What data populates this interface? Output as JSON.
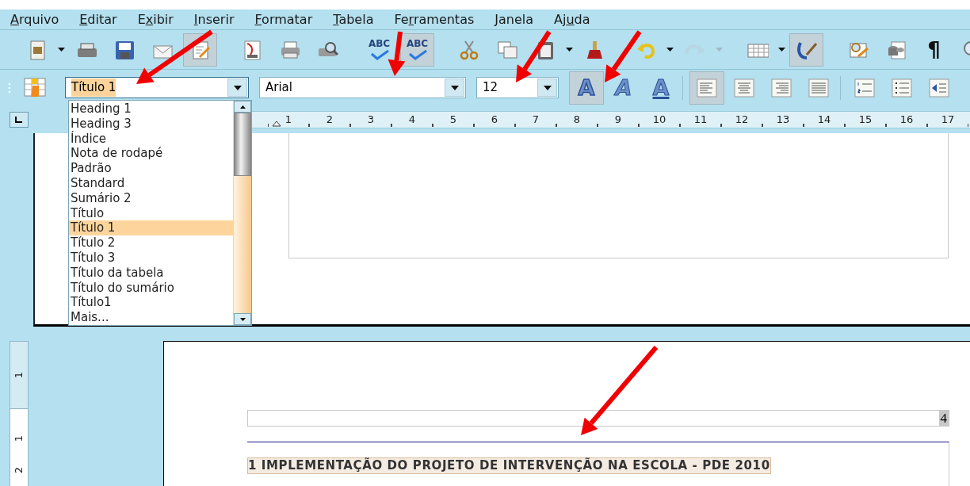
{
  "menu": [
    {
      "key": "A",
      "post": "rquivo"
    },
    {
      "key": "E",
      "post": "ditar"
    },
    {
      "pre": "E",
      "key": "x",
      "post": "ibir"
    },
    {
      "key": "I",
      "post": "nserir"
    },
    {
      "key": "F",
      "post": "ormatar"
    },
    {
      "key": "T",
      "post": "abela"
    },
    {
      "pre": "Fe",
      "key": "r",
      "post": "ramentas"
    },
    {
      "key": "J",
      "post": "anela"
    },
    {
      "pre": "Aj",
      "key": "u",
      "post": "da"
    }
  ],
  "standard_toolbar": [
    {
      "kind": "button",
      "pressed": false,
      "disabled": false,
      "menu": true
    },
    {
      "kind": "button",
      "pressed": false,
      "disabled": false,
      "menu": false
    },
    {
      "kind": "button",
      "pressed": false,
      "disabled": false,
      "menu": false
    },
    {
      "kind": "button",
      "pressed": false,
      "disabled": false,
      "menu": false
    },
    {
      "kind": "button",
      "pressed": true,
      "disabled": false,
      "menu": false
    },
    {
      "kind": "separator"
    },
    {
      "kind": "button",
      "pressed": false,
      "disabled": false,
      "menu": false
    },
    {
      "kind": "button",
      "pressed": false,
      "disabled": false,
      "menu": false
    },
    {
      "kind": "button",
      "pressed": false,
      "disabled": false,
      "menu": false
    },
    {
      "kind": "separator"
    },
    {
      "kind": "button",
      "pressed": false,
      "disabled": false,
      "menu": false,
      "glyph": "ABC"
    },
    {
      "kind": "button",
      "pressed": true,
      "disabled": false,
      "menu": false,
      "glyph": "ABC"
    },
    {
      "kind": "separator"
    },
    {
      "kind": "button",
      "pressed": false,
      "disabled": false,
      "menu": false
    },
    {
      "kind": "button",
      "pressed": false,
      "disabled": false,
      "menu": false
    },
    {
      "kind": "button",
      "pressed": false,
      "disabled": false,
      "menu": true
    },
    {
      "kind": "button",
      "pressed": false,
      "disabled": false,
      "menu": false
    },
    {
      "kind": "separator"
    },
    {
      "kind": "button",
      "pressed": false,
      "disabled": false,
      "menu": true
    },
    {
      "kind": "button",
      "pressed": false,
      "disabled": true,
      "menu": true
    },
    {
      "kind": "separator"
    },
    {
      "kind": "button",
      "pressed": false,
      "disabled": false,
      "menu": true
    },
    {
      "kind": "button",
      "pressed": true,
      "disabled": false,
      "menu": false
    },
    {
      "kind": "separator"
    },
    {
      "kind": "button",
      "pressed": false,
      "disabled": false,
      "menu": false
    },
    {
      "kind": "button",
      "pressed": false,
      "disabled": false,
      "menu": false
    },
    {
      "kind": "button",
      "pressed": false,
      "disabled": false,
      "menu": false,
      "glyph": "¶"
    },
    {
      "kind": "button",
      "pressed": false,
      "disabled": false,
      "menu": false
    }
  ],
  "formatting_toolbar": {
    "style_box": {
      "value": "Título 1",
      "expanded": true,
      "options": [
        {
          "label": "Heading 1",
          "selected": false
        },
        {
          "label": "Heading 3",
          "selected": false
        },
        {
          "label": "Índice",
          "selected": false
        },
        {
          "label": "Nota de rodapé",
          "selected": false
        },
        {
          "label": "Padrão",
          "selected": false
        },
        {
          "label": "Standard",
          "selected": false
        },
        {
          "label": "Sumário 2",
          "selected": false
        },
        {
          "label": "Título",
          "selected": false
        },
        {
          "label": "Título 1",
          "selected": true
        },
        {
          "label": "Título 2",
          "selected": false
        },
        {
          "label": "Título 3",
          "selected": false
        },
        {
          "label": "Título da tabela",
          "selected": false
        },
        {
          "label": "Título do sumário",
          "selected": false
        },
        {
          "label": "Título1",
          "selected": false
        },
        {
          "label": "Mais...",
          "selected": false
        }
      ]
    },
    "font_box": {
      "value": "Arial"
    },
    "size_box": {
      "value": "12"
    },
    "buttons": [
      {
        "kind": "bold",
        "glyph": "A",
        "pressed": true
      },
      {
        "kind": "italic",
        "glyph": "A",
        "pressed": false
      },
      {
        "kind": "underline",
        "glyph": "A",
        "pressed": false
      },
      {
        "kind": "separator"
      },
      {
        "kind": "align-left",
        "pressed": true
      },
      {
        "kind": "align-center",
        "pressed": false
      },
      {
        "kind": "align-right",
        "pressed": false
      },
      {
        "kind": "justify",
        "pressed": false
      },
      {
        "kind": "separator"
      },
      {
        "kind": "numbering",
        "pressed": false
      },
      {
        "kind": "bullets",
        "pressed": false
      },
      {
        "kind": "outdent",
        "pressed": false
      }
    ]
  },
  "ruler": {
    "labels": [
      "1",
      "2",
      "3",
      "4",
      "5",
      "6",
      "7",
      "8",
      "9",
      "10",
      "11",
      "12",
      "13",
      "14",
      "15",
      "16",
      "17"
    ]
  },
  "vertical_ruler": {
    "labels": [
      "1",
      "1",
      "2"
    ]
  },
  "document": {
    "page_number": "4",
    "heading": "1 IMPLEMENTAÇÃO DO PROJETO DE INTERVENÇÃO NA ESCOLA - PDE 2010"
  }
}
